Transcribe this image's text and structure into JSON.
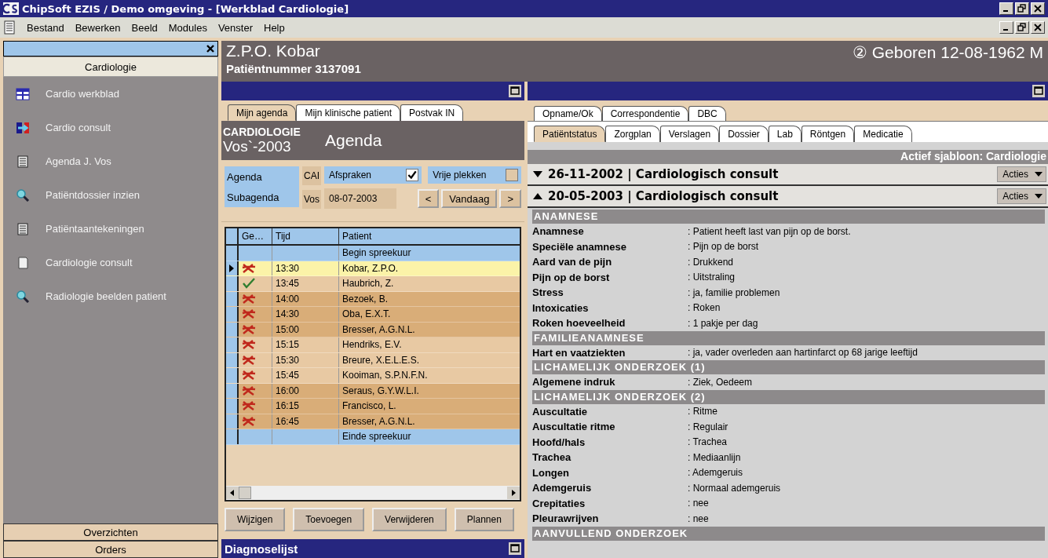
{
  "window": {
    "title": "ChipSoft EZIS / Demo omgeving - [Werkblad Cardiologie]"
  },
  "menu": [
    "Bestand",
    "Bewerken",
    "Beeld",
    "Modules",
    "Venster",
    "Help"
  ],
  "sidebar": {
    "group": "Cardiologie",
    "items": [
      {
        "label": "Cardio werkblad",
        "kind": "grid"
      },
      {
        "label": "Cardio consult",
        "kind": "swap"
      },
      {
        "label": "Agenda J. Vos",
        "kind": "notes"
      },
      {
        "label": "Patiëntdossier inzien",
        "kind": "search"
      },
      {
        "label": "Patiëntaantekeningen",
        "kind": "notes"
      },
      {
        "label": "Cardiologie consult",
        "kind": "page"
      },
      {
        "label": "Radiologie beelden patient",
        "kind": "search"
      }
    ],
    "bottom_groups": [
      "Overzichten",
      "Orders"
    ]
  },
  "patient": {
    "name": "Z.P.O. Kobar",
    "number": "Patiëntnummer 3137091",
    "born": "② Geboren 12-08-1962 M"
  },
  "agenda": {
    "tabs": [
      {
        "label": "Mijn agenda",
        "selected": true
      },
      {
        "label": "Mijn klinische patient",
        "selected": false
      },
      {
        "label": "Postvak IN",
        "selected": false
      }
    ],
    "department": "CARDIOLOGIE",
    "subtitle": "Vos`-2003",
    "title": "Agenda",
    "agenda_label": "Agenda",
    "agenda_value": "CAI",
    "subagenda_label": "Subagenda",
    "subagenda_value": "Vos",
    "filters": [
      {
        "label": "Afspraken",
        "checked": true
      },
      {
        "label": "Vrije plekken",
        "checked": false
      }
    ],
    "date": "08-07-2003",
    "nav": [
      "<",
      "Vandaag",
      ">"
    ],
    "columns": [
      "Ge…",
      "Tijd",
      "Patient"
    ],
    "rows": [
      {
        "kind": "marker",
        "patient": "Begin spreekuur",
        "selected": false
      },
      {
        "kind": "appointment",
        "done": false,
        "time": "13:30",
        "patient": "Kobar, Z.P.O.",
        "selected": true,
        "color": "#fbf3a8"
      },
      {
        "kind": "appointment",
        "done": true,
        "time": "13:45",
        "patient": "Haubrich, Z.",
        "selected": false,
        "color": "#e8c9a3"
      },
      {
        "kind": "appointment",
        "done": false,
        "time": "14:00",
        "patient": "Bezoek, B.",
        "selected": false,
        "color": "#d9ad78"
      },
      {
        "kind": "appointment",
        "done": false,
        "time": "14:30",
        "patient": "Oba, E.X.T.",
        "selected": false,
        "color": "#d9ad78"
      },
      {
        "kind": "appointment",
        "done": false,
        "time": "15:00",
        "patient": "Bresser, A.G.N.L.",
        "selected": false,
        "color": "#d9ad78"
      },
      {
        "kind": "appointment",
        "done": false,
        "time": "15:15",
        "patient": "Hendriks, E.V.",
        "selected": false,
        "color": "#e8c9a3"
      },
      {
        "kind": "appointment",
        "done": false,
        "time": "15:30",
        "patient": "Breure, X.E.L.E.S.",
        "selected": false,
        "color": "#e8c9a3"
      },
      {
        "kind": "appointment",
        "done": false,
        "time": "15:45",
        "patient": "Kooiman, S.P.N.F.N.",
        "selected": false,
        "color": "#e8c9a3"
      },
      {
        "kind": "appointment",
        "done": false,
        "time": "16:00",
        "patient": "Seraus, G.Y.W.L.I.",
        "selected": false,
        "color": "#d9ad78"
      },
      {
        "kind": "appointment",
        "done": false,
        "time": "16:15",
        "patient": "Francisco, L.",
        "selected": false,
        "color": "#d9ad78"
      },
      {
        "kind": "appointment",
        "done": false,
        "time": "16:45",
        "patient": "Bresser, A.G.N.L.",
        "selected": false,
        "color": "#d9ad78"
      },
      {
        "kind": "marker",
        "patient": "Einde spreekuur",
        "selected": false
      }
    ],
    "buttons": [
      "Wijzigen",
      "Toevoegen",
      "Verwijderen",
      "Plannen"
    ],
    "diagnoses_title": "Diagnoselijst"
  },
  "record": {
    "tabs_back": [
      {
        "label": "Opname/Ok",
        "selected": false
      },
      {
        "label": "Correspondentie",
        "selected": false
      },
      {
        "label": "DBC",
        "selected": false
      }
    ],
    "tabs_front": [
      {
        "label": "Patiëntstatus",
        "selected": true
      },
      {
        "label": "Zorgplan",
        "selected": false
      },
      {
        "label": "Verslagen",
        "selected": false
      },
      {
        "label": "Dossier",
        "selected": false
      },
      {
        "label": "Lab",
        "selected": false
      },
      {
        "label": "Röntgen",
        "selected": false
      },
      {
        "label": "Medicatie",
        "selected": false
      }
    ],
    "template": "Actief sjabloon: Cardiologie",
    "consults": [
      {
        "title": "26-11-2002 | Cardiologisch consult",
        "expanded": false,
        "action": "Acties"
      },
      {
        "title": "20-05-2003 | Cardiologisch consult",
        "expanded": true,
        "action": "Acties"
      }
    ],
    "sections": [
      {
        "title": "ANAMNESE",
        "rows": [
          {
            "label": "Anamnese",
            "value": ": Patient heeft last van pijn op de borst."
          },
          {
            "label": "Speciële anamnese",
            "value": ": Pijn op de borst"
          },
          {
            "label": "Aard van de pijn",
            "value": ": Drukkend"
          },
          {
            "label": "Pijn op de borst",
            "value": ": Uitstraling"
          },
          {
            "label": "Stress",
            "value": ": ja, familie problemen"
          },
          {
            "label": "Intoxicaties",
            "value": ": Roken"
          },
          {
            "label": "Roken hoeveelheid",
            "value": ": 1 pakje per dag"
          }
        ]
      },
      {
        "title": "FAMILIEANAMNESE",
        "rows": [
          {
            "label": "Hart en vaatziekten",
            "value": ": ja, vader overleden aan hartinfarct op 68 jarige leeftijd"
          }
        ]
      },
      {
        "title": "LICHAMELIJK ONDERZOEK (1)",
        "rows": [
          {
            "label": "Algemene indruk",
            "value": ": Ziek, Oedeem"
          }
        ]
      },
      {
        "title": "LICHAMELIJK ONDERZOEK (2)",
        "rows": [
          {
            "label": "Auscultatie",
            "value": ": Ritme"
          },
          {
            "label": "Auscultatie ritme",
            "value": ": Regulair"
          },
          {
            "label": "Hoofd/hals",
            "value": ": Trachea"
          },
          {
            "label": "Trachea",
            "value": ": Mediaanlijn"
          },
          {
            "label": "Longen",
            "value": ": Ademgeruis"
          },
          {
            "label": "Ademgeruis",
            "value": ": Normaal ademgeruis"
          },
          {
            "label": "Crepitaties",
            "value": ": nee"
          },
          {
            "label": "Pleurawrijven",
            "value": ": nee"
          }
        ]
      },
      {
        "title": "AANVULLEND ONDERZOEK"
      }
    ]
  }
}
